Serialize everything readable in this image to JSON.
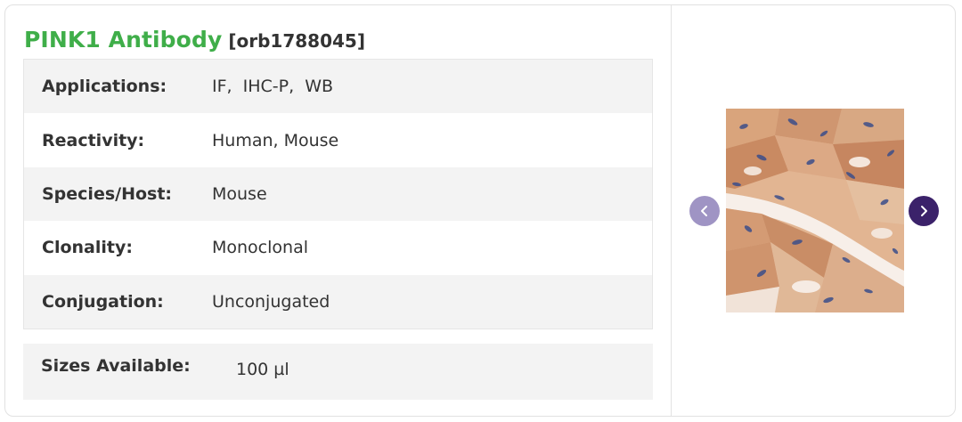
{
  "product": {
    "name": "PINK1 Antibody",
    "catalog_number": "[orb1788045]"
  },
  "specs": [
    {
      "label": "Applications:",
      "value": "IF,  IHC-P,  WB"
    },
    {
      "label": "Reactivity:",
      "value": "Human, Mouse"
    },
    {
      "label": "Species/Host:",
      "value": "Mouse"
    },
    {
      "label": "Clonality:",
      "value": "Monoclonal"
    },
    {
      "label": "Conjugation:",
      "value": "Unconjugated"
    }
  ],
  "sizes": {
    "label": "Sizes Available:",
    "value": "100 µl"
  },
  "gallery": {
    "image_semantic": "ihc-tissue-stain-image",
    "prev_icon": "chevron-left-icon",
    "next_icon": "chevron-right-icon"
  },
  "colors": {
    "title_green": "#3fae49",
    "text_dark": "#333333",
    "row_shade": "#f3f3f3",
    "nav_prev": "#9f94c4",
    "nav_next": "#3b226a"
  }
}
